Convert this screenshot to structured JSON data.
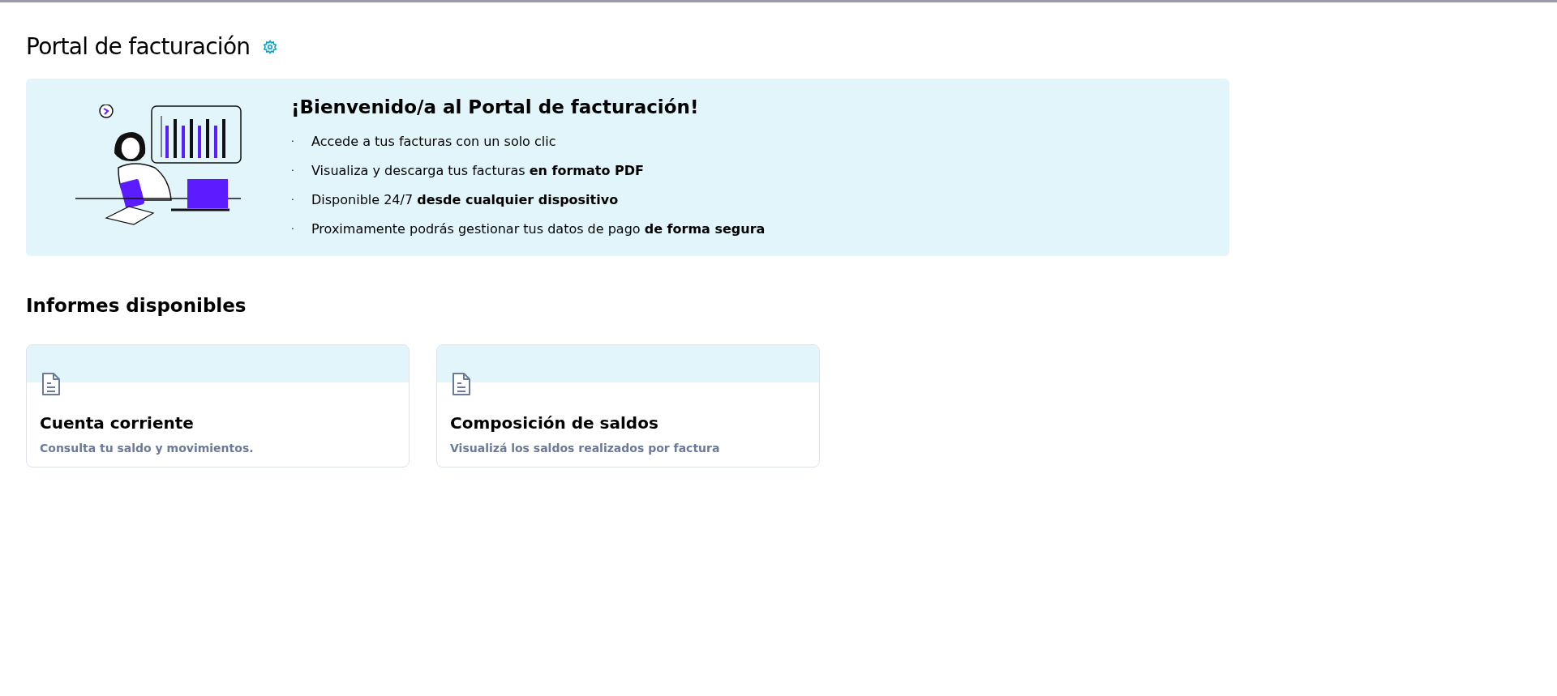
{
  "page": {
    "title": "Portal de facturación"
  },
  "banner": {
    "heading": "¡Bienvenido/a al Portal de facturación!",
    "bullet": "·",
    "items": [
      "Accede a tus facturas con un solo clic",
      "Visualiza y descarga tus facturas **en formato PDF**",
      "Disponible 24/7 **desde cualquier dispositivo**",
      "Proximamente podrás gestionar tus datos de pago **de forma segura**"
    ]
  },
  "reports": {
    "heading": "Informes disponibles",
    "cards": [
      {
        "title": "Cuenta corriente",
        "description": "Consulta tu saldo y movimientos."
      },
      {
        "title": "Composición de saldos",
        "description": "Visualizá los saldos realizados por factura"
      }
    ]
  }
}
